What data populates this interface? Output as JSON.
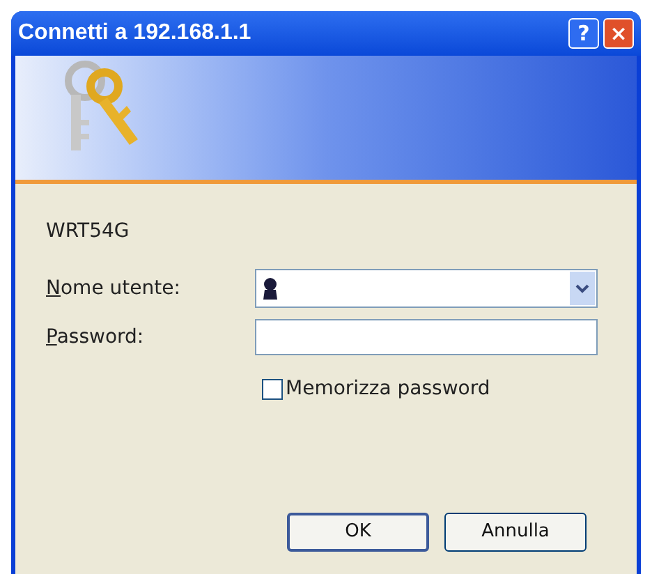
{
  "window": {
    "title": "Connetti a 192.168.1.1",
    "buttons": [
      "?",
      "×"
    ]
  },
  "realm": "WRT54G",
  "fields": [
    {
      "label": "Nome utente:",
      "first_letter_underlined": true,
      "kind": "combo"
    },
    {
      "label": "Password:",
      "first_letter_underlined": true,
      "kind": "password"
    }
  ],
  "remember": {
    "label": "Memorizza password",
    "checked": false
  },
  "buttons": [
    {
      "label": "OK",
      "default": true
    },
    {
      "label": "Annulla",
      "default": false
    }
  ]
}
